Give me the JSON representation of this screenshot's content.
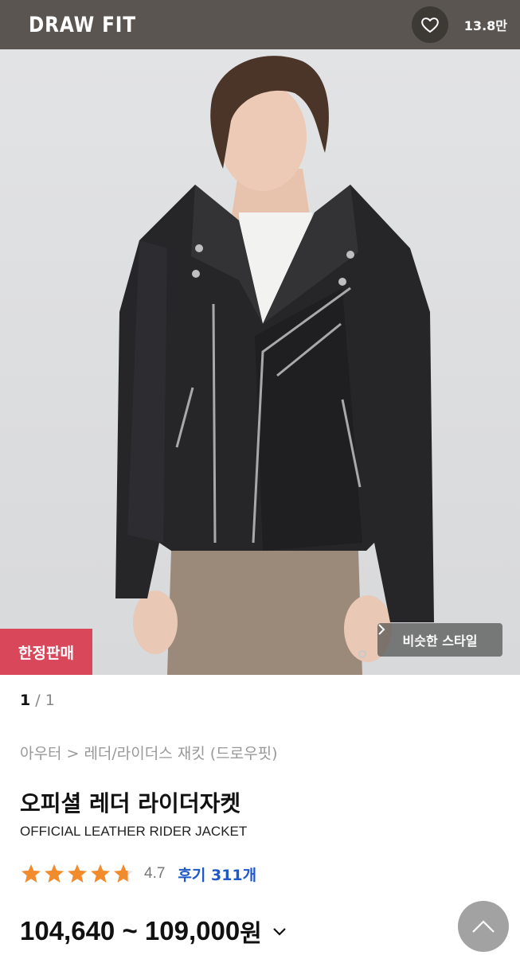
{
  "header": {
    "brand": "DRAW FIT",
    "like_count": "13.8만",
    "like_icon": "heart-outline-icon"
  },
  "hero": {
    "limited_badge": "한정판매",
    "similar_style": "비슷한 스타일",
    "similar_icon": "chevron-right-icon"
  },
  "pager": {
    "current": "1",
    "separator": " / ",
    "total": "1"
  },
  "product": {
    "breadcrumb": "아우터 > 레더/라이더스 재킷 (드로우핏)",
    "name_ko": "오피셜 레더 라이더자켓",
    "name_en": "OFFICIAL LEATHER RIDER JACKET",
    "rating": "4.7",
    "rating_stars": 4.7,
    "review_label": "후기 311개",
    "price_range": "104,640 ~ 109,000",
    "price_unit": "원",
    "price_dropdown_icon": "chevron-down-icon"
  },
  "colors": {
    "header_bg": "#5a5550",
    "badge_red": "#d9475a",
    "star_orange": "#f28b2c",
    "review_blue": "#1f58c8"
  },
  "scroll_top_icon": "chevron-up-icon"
}
